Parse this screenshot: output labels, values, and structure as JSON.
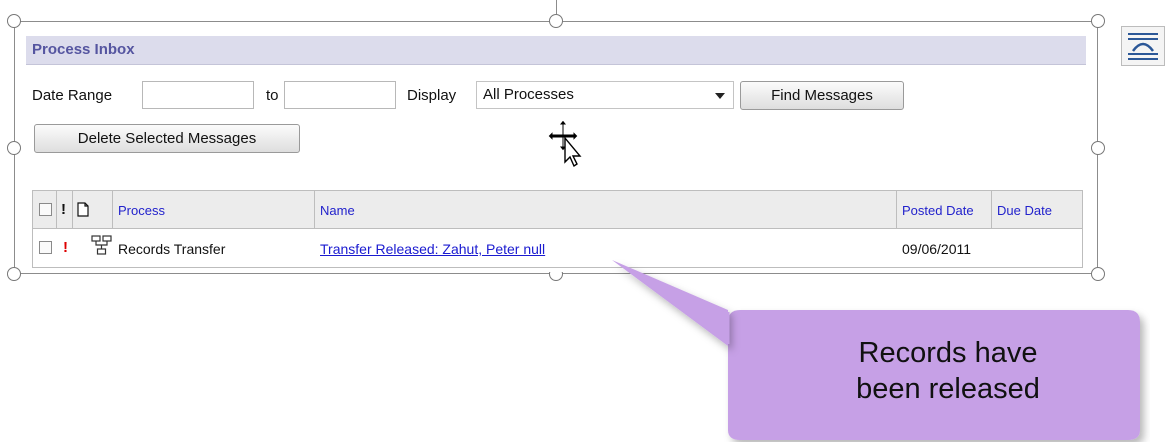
{
  "panel": {
    "title": "Process Inbox"
  },
  "filters": {
    "date_range_label": "Date Range",
    "to_label": "to",
    "date_from_value": "",
    "date_to_value": "",
    "display_label": "Display",
    "display_selected": "All Processes",
    "find_button": "Find Messages",
    "delete_button": "Delete Selected Messages"
  },
  "table": {
    "columns": [
      "Process",
      "Name",
      "Posted Date",
      "Due Date"
    ],
    "rows": [
      {
        "process": "Records Transfer",
        "name": "Transfer Released: Zahut, Peter null",
        "posted_date": "09/06/2011",
        "due_date": ""
      }
    ]
  },
  "callout": {
    "line1": "Records have",
    "line2": "been released"
  },
  "colors": {
    "header_bg": "#dcdcec",
    "header_text": "#5555a0",
    "link": "#1a1ad0",
    "callout_fill": "#c6a0e6",
    "priority": "#dd0000"
  }
}
